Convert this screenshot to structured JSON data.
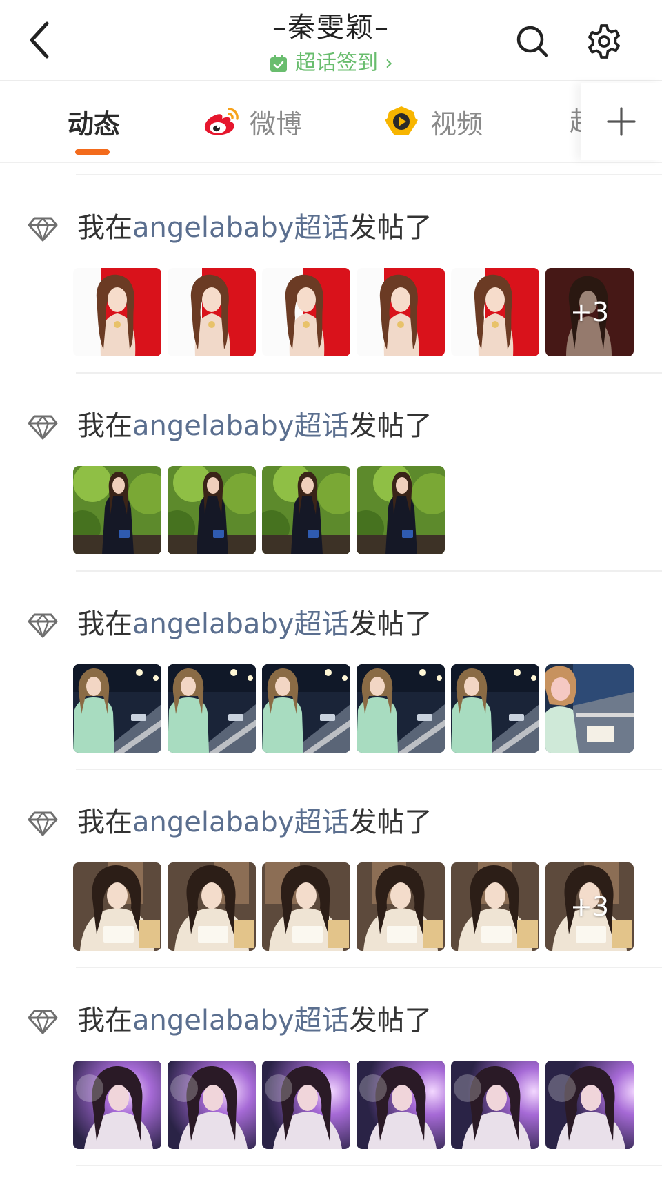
{
  "header": {
    "title": "–秦雯颖–",
    "checkin_label": "超话签到",
    "checkin_chevron": "›"
  },
  "tabs": [
    {
      "label": "动态",
      "icon": "none",
      "active": true
    },
    {
      "label": "微博",
      "icon": "weibo-logo-icon",
      "active": false
    },
    {
      "label": "视频",
      "icon": "video-play-badge-icon",
      "active": false
    },
    {
      "label": "超",
      "icon": "none",
      "active": false
    }
  ],
  "colors": {
    "accent_orange": "#f36b1c",
    "checkin_green": "#69bd6e",
    "link_blue": "#5b6f8f"
  },
  "posts": [
    {
      "prefix": "我在",
      "link": "angelababy超话",
      "suffix": "发帖了",
      "thumbs": [
        {
          "scene": "red-carpet-white-dress"
        },
        {
          "scene": "red-carpet-white-dress"
        },
        {
          "scene": "red-carpet-white-dress"
        },
        {
          "scene": "red-carpet-white-dress"
        },
        {
          "scene": "red-carpet-white-dress"
        },
        {
          "scene": "red-carpet-dark",
          "more": "+3"
        }
      ]
    },
    {
      "prefix": "我在",
      "link": "angelababy超话",
      "suffix": "发帖了",
      "thumbs": [
        {
          "scene": "garden-black-outfit"
        },
        {
          "scene": "garden-black-outfit"
        },
        {
          "scene": "garden-black-outfit"
        },
        {
          "scene": "garden-black-outfit"
        }
      ]
    },
    {
      "prefix": "我在",
      "link": "angelababy超话",
      "suffix": "发帖了",
      "thumbs": [
        {
          "scene": "racetrack-night-mint-jacket"
        },
        {
          "scene": "racetrack-night-mint-jacket"
        },
        {
          "scene": "racetrack-night-mint-jacket"
        },
        {
          "scene": "racetrack-night-mint-jacket"
        },
        {
          "scene": "racetrack-night-mint-jacket"
        },
        {
          "scene": "racetrack-selfie"
        }
      ]
    },
    {
      "prefix": "我在",
      "link": "angelababy超话",
      "suffix": "发帖了",
      "thumbs": [
        {
          "scene": "fan-signing-cream-dress"
        },
        {
          "scene": "fan-signing-cream-dress"
        },
        {
          "scene": "fan-signing-cream-dress"
        },
        {
          "scene": "fan-signing-cream-dress"
        },
        {
          "scene": "fan-signing-cream-dress"
        },
        {
          "scene": "fan-signing-cream-dress",
          "more": "+3"
        }
      ]
    },
    {
      "prefix": "我在",
      "link": "angelababy超话",
      "suffix": "发帖了",
      "thumbs": [
        {
          "scene": "purple-glow-portrait"
        },
        {
          "scene": "purple-glow-portrait"
        },
        {
          "scene": "purple-glow-portrait"
        },
        {
          "scene": "purple-glow-portrait"
        },
        {
          "scene": "purple-glow-portrait"
        },
        {
          "scene": "purple-glow-portrait"
        }
      ]
    }
  ]
}
